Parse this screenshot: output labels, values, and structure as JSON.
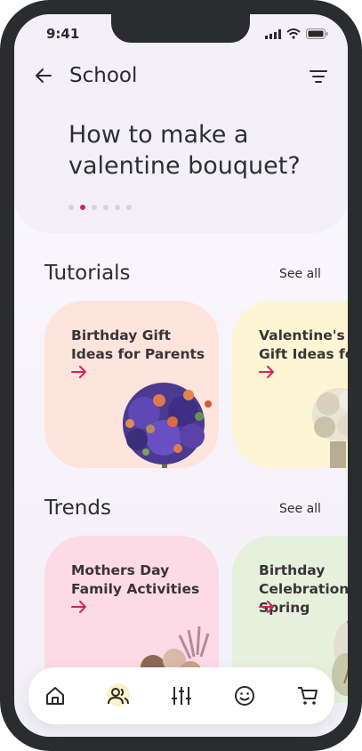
{
  "status": {
    "time": "9:41"
  },
  "header": {
    "title": "School"
  },
  "hero": {
    "title": "How to make a valentine bouquet?",
    "dots_count": 6,
    "active_dot": 1
  },
  "tutorials": {
    "title": "Tutorials",
    "see_all": "See all",
    "cards": [
      {
        "label": "Birthday Gift Ideas for Parents",
        "bg": "#fde4dc"
      },
      {
        "label": "Valentine's Day Gift Ideas for",
        "bg": "#fdf5d3"
      }
    ]
  },
  "trends": {
    "title": "Trends",
    "see_all": "See all",
    "cards": [
      {
        "label": "Mothers Day Family Activities",
        "bg": "#fcdbe6"
      },
      {
        "label": "Birthday Celebration in the Spring",
        "bg": "#e5f1dc"
      }
    ]
  },
  "bottom_nav": [
    {
      "icon": "home-icon"
    },
    {
      "icon": "users-icon"
    },
    {
      "icon": "sliders-icon"
    },
    {
      "icon": "smile-icon"
    },
    {
      "icon": "cart-icon"
    }
  ],
  "colors": {
    "accent": "#d1245c",
    "dark": "#2b2c2f"
  }
}
